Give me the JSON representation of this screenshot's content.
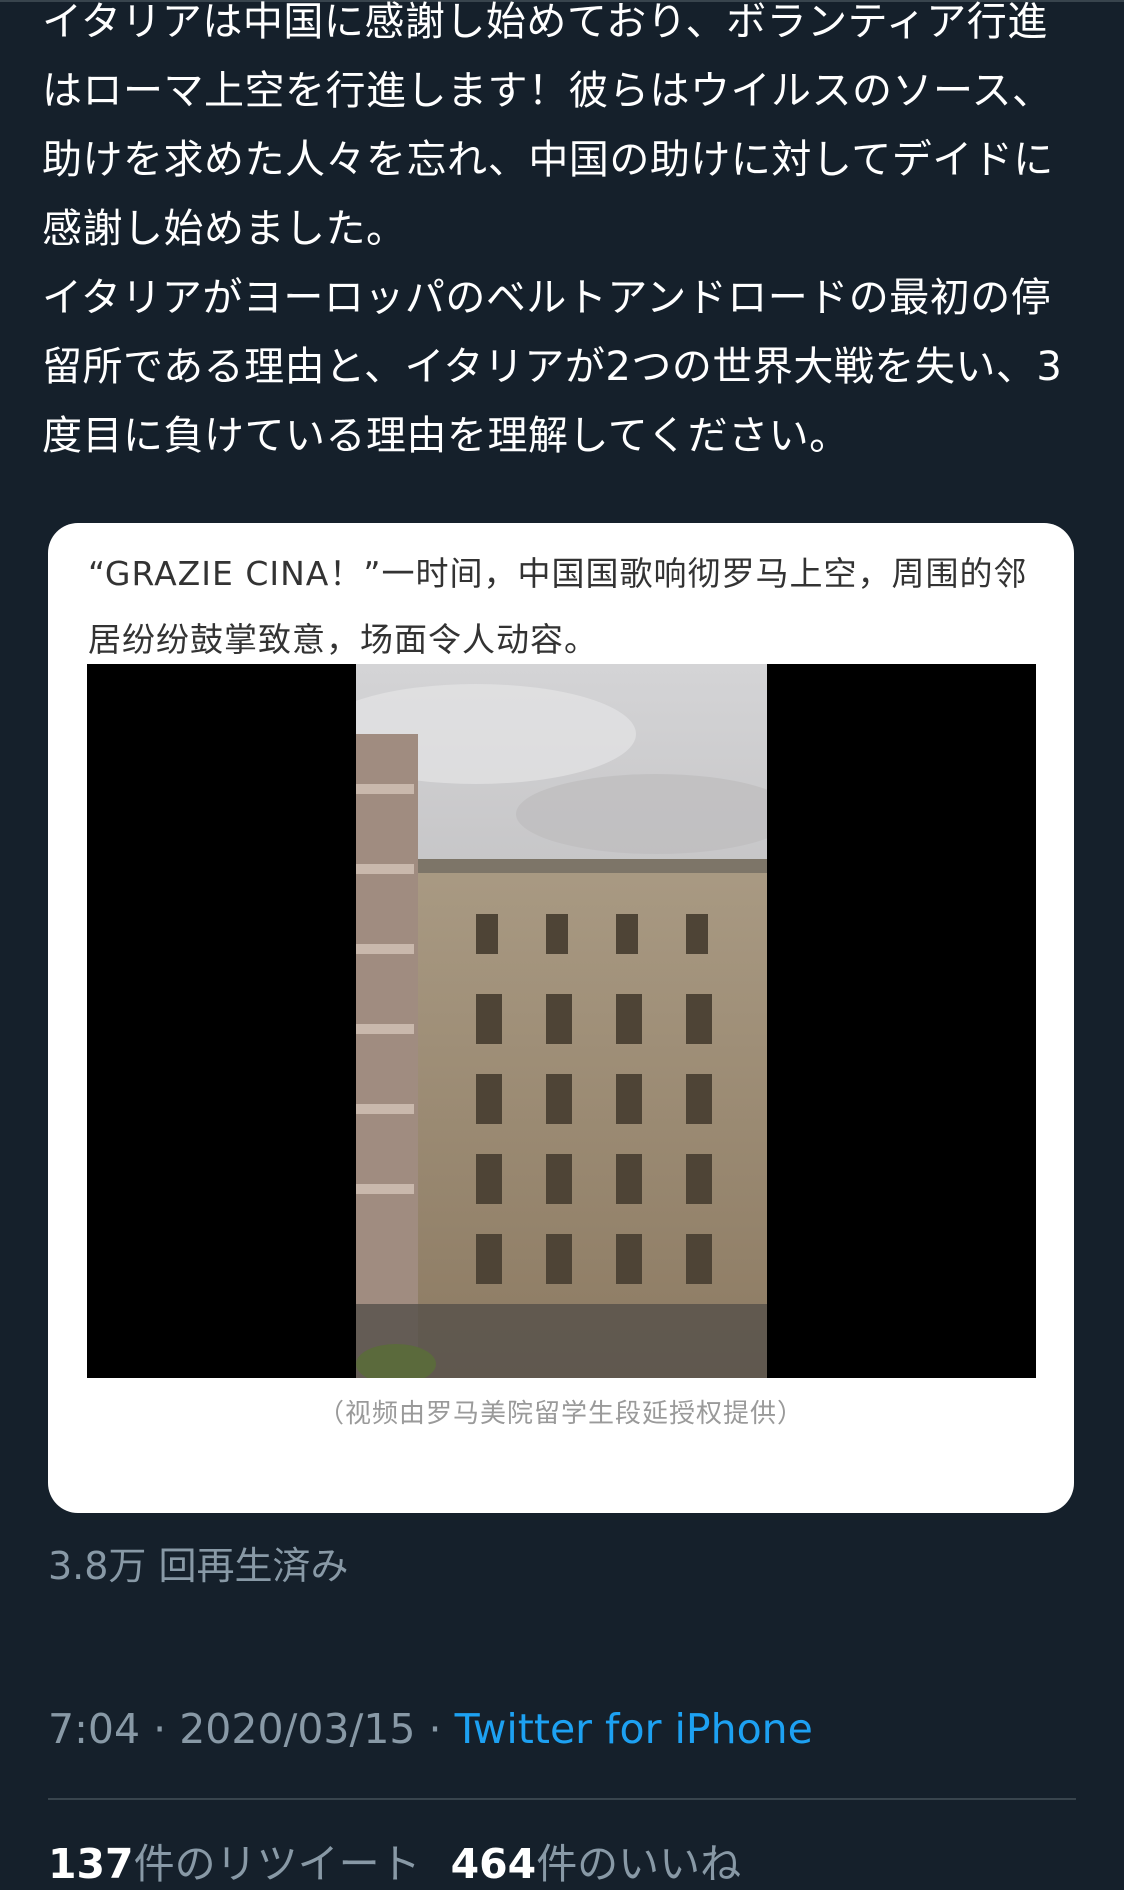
{
  "tweet": {
    "paragraphs": [
      "イタリアは中国に感謝し始めており、ボランティア行進はローマ上空を行進します！彼らはウイルスのソース、助けを求めた人々を忘れ、中国の助けに対してデイドに感謝し始めました。",
      "イタリアがヨーロッパのベルトアンドロードの最初の停留所である理由と、イタリアが2つの世界大戦を失い、3度目に負けている理由を理解してください。"
    ]
  },
  "media": {
    "caption": "“GRAZIE CINA！”一时间，中国国歌响彻罗马上空，周围的邻居纷纷鼓掌致意，场面令人动容。",
    "credit": "（视频由罗马美院留学生段延授权提供）"
  },
  "view_count": "3.8万 回再生済み",
  "meta": {
    "time": "7:04",
    "separator": " · ",
    "date": "2020/03/15",
    "source": "Twitter for iPhone"
  },
  "stats": {
    "retweets_count": "137",
    "retweets_label": "件のリツイート",
    "likes_count": "464",
    "likes_label": "件のいいね"
  },
  "colors": {
    "background": "#15202b",
    "secondary_text": "#8899a6",
    "accent": "#1da1f2",
    "divider": "#38444d"
  }
}
